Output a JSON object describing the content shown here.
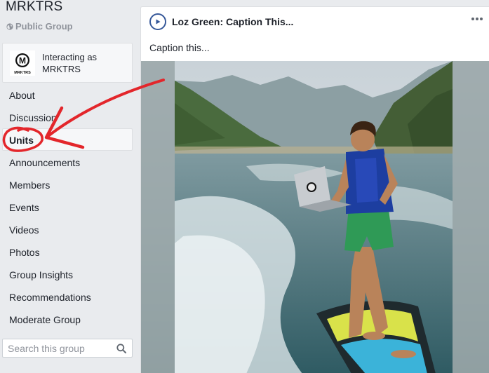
{
  "group": {
    "name": "MRKTRS",
    "privacy": "Public Group",
    "privacy_icon": "globe-icon"
  },
  "interacting": {
    "label_line1": "Interacting as",
    "label_line2": "MRKTRS",
    "avatar_text": "MRKTRS",
    "avatar_letter": "M"
  },
  "nav": {
    "items": [
      {
        "label": "About"
      },
      {
        "label": "Discussion"
      },
      {
        "label": "Units",
        "active": true
      },
      {
        "label": "Announcements"
      },
      {
        "label": "Members"
      },
      {
        "label": "Events"
      },
      {
        "label": "Videos"
      },
      {
        "label": "Photos"
      },
      {
        "label": "Group Insights"
      },
      {
        "label": "Recommendations"
      },
      {
        "label": "Moderate Group"
      }
    ]
  },
  "search": {
    "placeholder": "Search this group",
    "icon": "search-icon"
  },
  "post": {
    "title": "Loz Green: Caption This...",
    "text": "Caption this...",
    "page_icon": "play-icon",
    "menu_icon": "more-dots-icon",
    "media_icon": "video-thumbnail"
  },
  "colors": {
    "annotation": "#e3262b",
    "brand_blue": "#365899",
    "sidebar_bg": "#e9ebee"
  }
}
